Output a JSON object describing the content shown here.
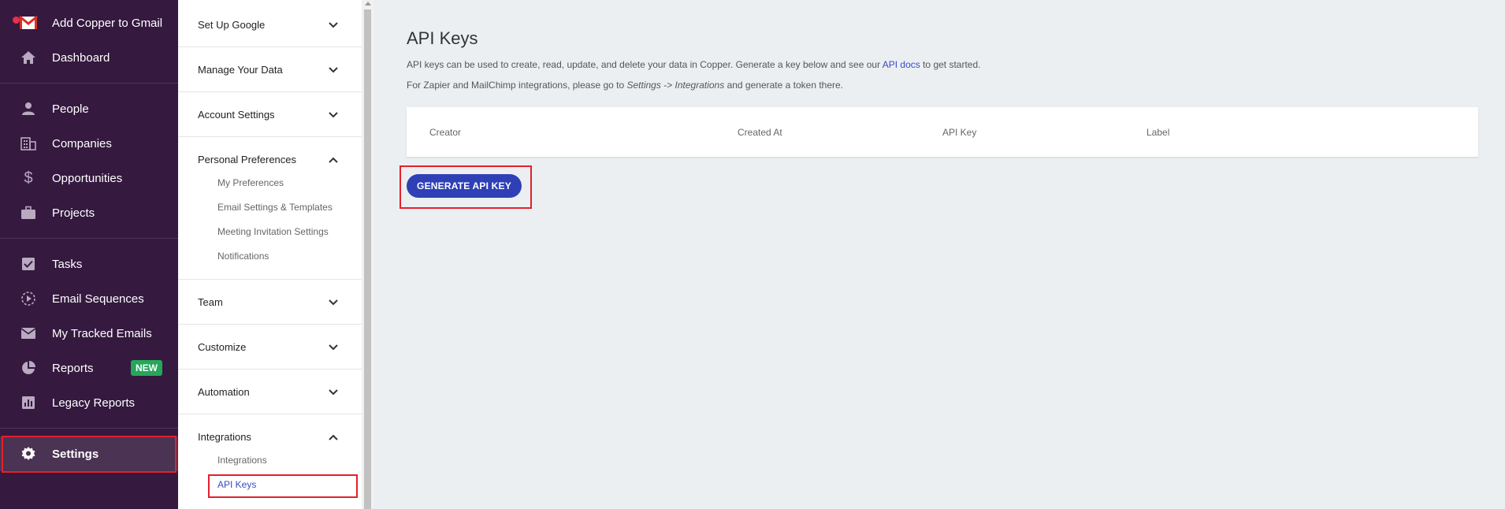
{
  "left_nav": {
    "items": [
      {
        "label": "Add Copper to Gmail",
        "icon": "gmail-icon"
      },
      {
        "label": "Dashboard",
        "icon": "home-icon"
      },
      {
        "label": "People",
        "icon": "person-icon"
      },
      {
        "label": "Companies",
        "icon": "building-icon"
      },
      {
        "label": "Opportunities",
        "icon": "dollar-icon"
      },
      {
        "label": "Projects",
        "icon": "briefcase-icon"
      },
      {
        "label": "Tasks",
        "icon": "checkbox-icon"
      },
      {
        "label": "Email Sequences",
        "icon": "sequence-icon"
      },
      {
        "label": "My Tracked Emails",
        "icon": "envelope-icon"
      },
      {
        "label": "Reports",
        "icon": "pie-chart-icon",
        "badge": "NEW"
      },
      {
        "label": "Legacy Reports",
        "icon": "bar-chart-icon"
      },
      {
        "label": "Settings",
        "icon": "gear-icon",
        "active": true
      }
    ]
  },
  "settings_panel": {
    "sections": [
      {
        "label": "Set Up Google",
        "expanded": false
      },
      {
        "label": "Manage Your Data",
        "expanded": false
      },
      {
        "label": "Account Settings",
        "expanded": false
      },
      {
        "label": "Personal Preferences",
        "expanded": true,
        "children": [
          "My Preferences",
          "Email Settings & Templates",
          "Meeting Invitation Settings",
          "Notifications"
        ]
      },
      {
        "label": "Team",
        "expanded": false
      },
      {
        "label": "Customize",
        "expanded": false
      },
      {
        "label": "Automation",
        "expanded": false
      },
      {
        "label": "Integrations",
        "expanded": true,
        "children": [
          "Integrations",
          "API Keys"
        ]
      }
    ],
    "active_child": "API Keys"
  },
  "main": {
    "title": "API Keys",
    "desc1_pre": "API keys can be used to create, read, update, and delete your data in Copper. Generate a key below and see our ",
    "desc1_link": "API docs",
    "desc1_post": " to get started.",
    "desc2_pre": "For Zapier and MailChimp integrations, please go to ",
    "desc2_em": "Settings -> Integrations",
    "desc2_post": " and generate a token there.",
    "table_headers": [
      "Creator",
      "Created At",
      "API Key",
      "Label"
    ],
    "generate_button": "GENERATE API KEY"
  },
  "colors": {
    "nav_bg": "#35193f",
    "accent": "#2f40b6",
    "badge_green": "#26a65b",
    "highlight_red": "#e3212b"
  }
}
